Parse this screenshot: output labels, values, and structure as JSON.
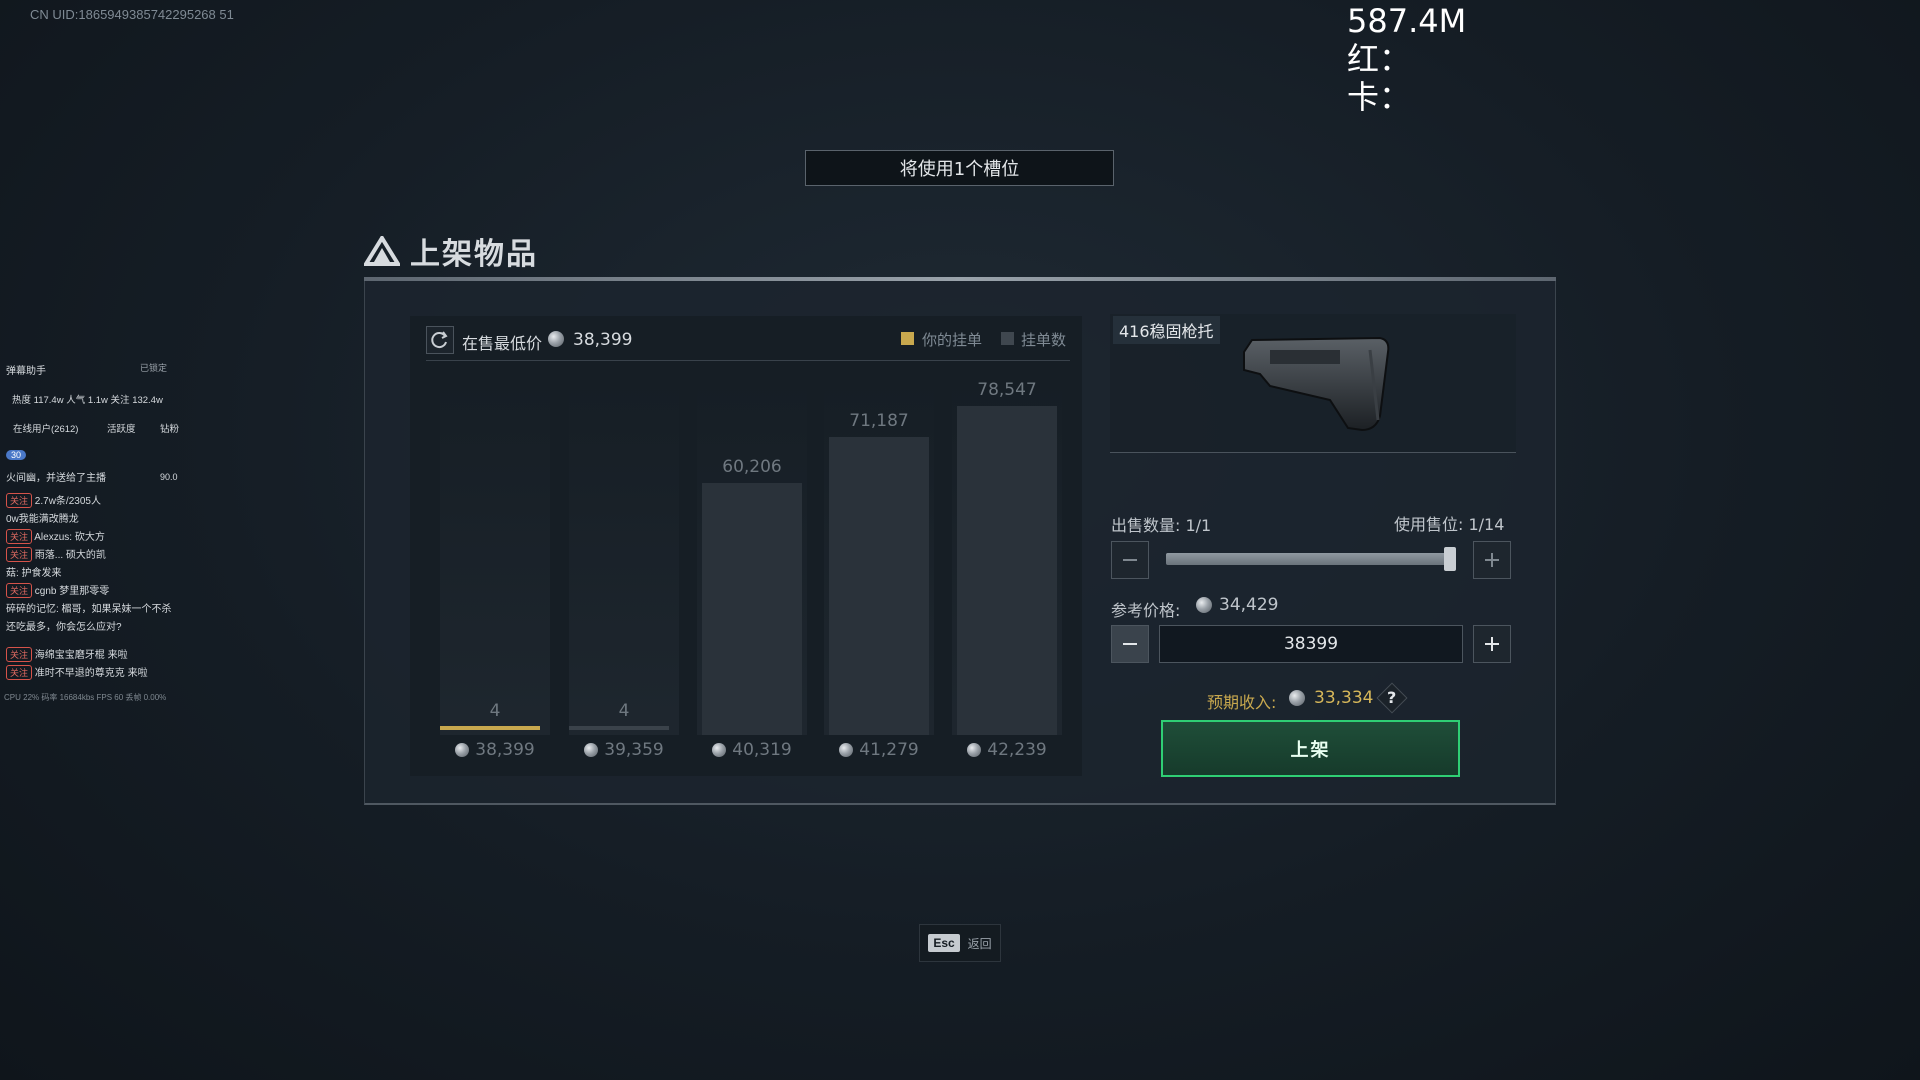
{
  "uid": "CN UID:1865949385742295268 51",
  "overlay": {
    "total": "587.4M",
    "red": "红：",
    "card": "卡："
  },
  "slot_banner": "将使用1个槽位",
  "dialog": {
    "title": "上架物品",
    "chart": {
      "lowest_label": "在售最低价",
      "lowest_value": "38,399",
      "legend_mine": "你的挂单",
      "legend_count": "挂单数"
    },
    "item_name": "416稳固枪托",
    "quantity_label": "出售数量: 1/1",
    "slots_label": "使用售位: 1/14",
    "quantity_fraction": 1.0,
    "ref_price_label": "参考价格:",
    "ref_price_value": "34,429",
    "price_input_value": "38399",
    "income_label": "预期收入:",
    "income_value": "33,334",
    "help_symbol": "?",
    "list_button": "上架"
  },
  "chart_data": {
    "type": "bar",
    "categories": [
      "38,399",
      "39,359",
      "40,319",
      "41,279",
      "42,239"
    ],
    "values": [
      4,
      4,
      60206,
      71187,
      78547
    ],
    "value_labels": [
      "4",
      "4",
      "60,206",
      "71,187",
      "78,547"
    ],
    "mine_index": 0,
    "colors": {
      "mine": "#c8a84e",
      "bar": "#2a323a",
      "label": "#6f7880"
    }
  },
  "esc": {
    "key": "Esc",
    "label": "返回"
  },
  "chat": {
    "title": "弹幕助手",
    "locked": "已锁定",
    "stats": "热度 117.4w  人气 1.1w  关注 132.4w",
    "tabs": [
      "在线用户(2612)",
      "活跃度",
      "钻粉"
    ],
    "gift_badge": "30",
    "gift_line": "火间幽，并送给了主播",
    "gift_value": "90.0",
    "rows": [
      {
        "prefix": "关注",
        "text": "2.7w条/2305人"
      },
      {
        "prefix": "",
        "text": "0w我能满改腾龙"
      },
      {
        "prefix": "关注",
        "text": "Alexzus: 砍大方"
      },
      {
        "prefix": "关注",
        "text": "雨落... 硕大的凯"
      },
      {
        "prefix": "",
        "text": "菇: 护食发来"
      },
      {
        "prefix": "关注",
        "text": "cgnb  梦里那零零"
      },
      {
        "prefix": "",
        "text": "碎碎的记忆: 楣哥，如果呆妹一个不杀"
      },
      {
        "prefix": "",
        "text": "还吃最多，你会怎么应对?"
      },
      {
        "prefix": "关注",
        "text": "海绵宝宝磨牙棍 来啦"
      },
      {
        "prefix": "关注",
        "text": "准时不早退的尊克克 来啦"
      }
    ],
    "footer": "CPU 22%  码率 16684kbs  FPS 60  丢帧 0.00%"
  }
}
